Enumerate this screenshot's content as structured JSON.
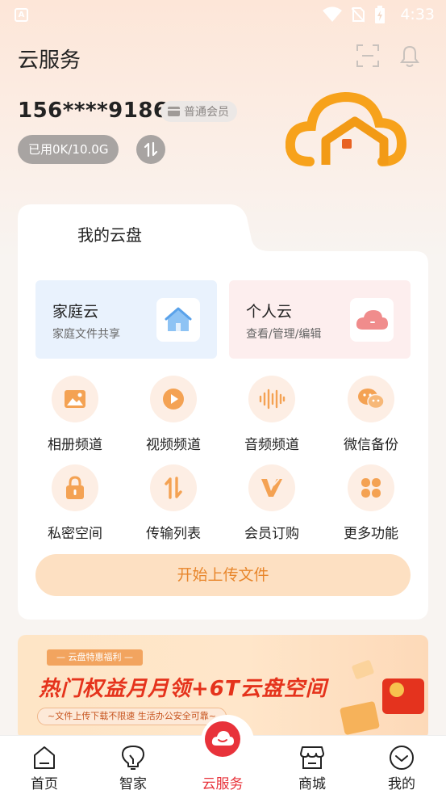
{
  "status_bar": {
    "time": "4:33"
  },
  "header": {
    "title": "云服务"
  },
  "account": {
    "phone": "156****9186",
    "member_level": "普通会员",
    "storage": "已用0K/10.0G"
  },
  "drive": {
    "title": "我的云盘",
    "family": {
      "title": "家庭云",
      "subtitle": "家庭文件共享"
    },
    "personal": {
      "title": "个人云",
      "subtitle": "查看/管理/编辑"
    },
    "features": [
      {
        "label": "相册频道",
        "icon": "photo-icon"
      },
      {
        "label": "视频频道",
        "icon": "play-icon"
      },
      {
        "label": "音频频道",
        "icon": "audio-wave-icon"
      },
      {
        "label": "微信备份",
        "icon": "wechat-icon"
      },
      {
        "label": "私密空间",
        "icon": "lock-icon"
      },
      {
        "label": "传输列表",
        "icon": "transfer-icon"
      },
      {
        "label": "会员订购",
        "icon": "vip-icon"
      },
      {
        "label": "更多功能",
        "icon": "more-icon"
      }
    ],
    "upload_label": "开始上传文件"
  },
  "banner": {
    "tag": "— 云盘特惠福利 —",
    "headline": "热门权益月月领+6T云盘空间",
    "subline": "~文件上传下载不限速  生活办公安全可靠~"
  },
  "tabbar": {
    "items": [
      {
        "label": "首页",
        "icon": "home-icon"
      },
      {
        "label": "智家",
        "icon": "bulb-icon"
      },
      {
        "label": "云服务",
        "icon": "cloud-service-icon"
      },
      {
        "label": "商城",
        "icon": "store-icon"
      },
      {
        "label": "我的",
        "icon": "profile-icon"
      }
    ],
    "active": "云服务"
  },
  "colors": {
    "accent": "#e8862b",
    "active_tab": "#e8323a",
    "family_bg": "#e9f2fd",
    "personal_bg": "#fdeeee"
  }
}
